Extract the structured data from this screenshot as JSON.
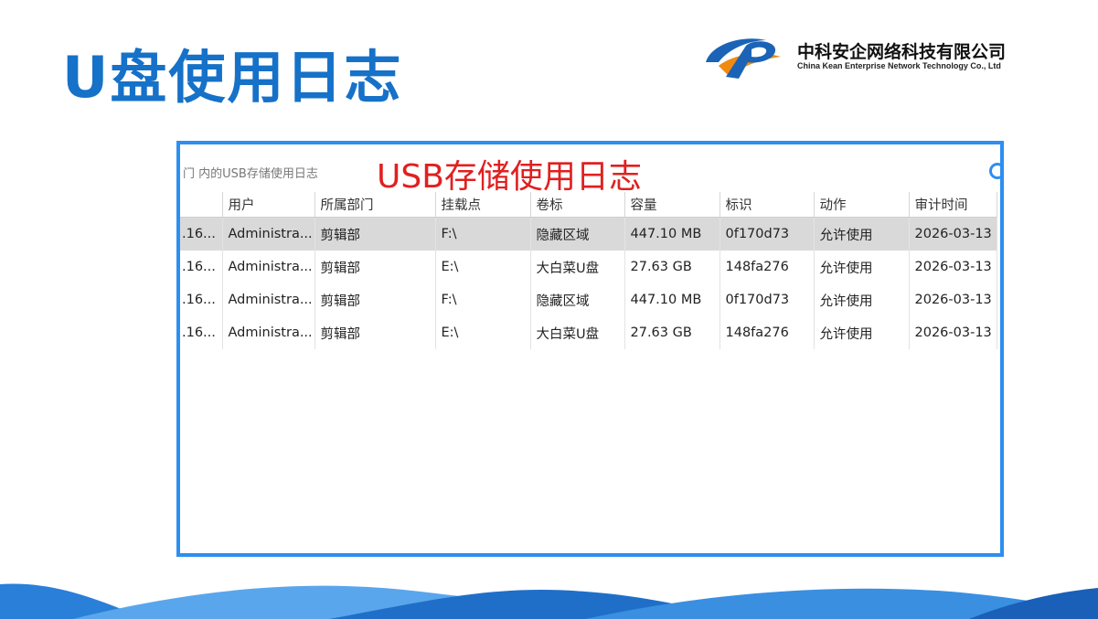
{
  "slide": {
    "title": "U盘使用日志",
    "title_color": "#1671c8"
  },
  "logo": {
    "company_cn": "中科安企网络科技有限公司",
    "company_en": "China Kean Enterprise Network Technology Co., Ltd"
  },
  "window": {
    "toolbar_text": "门 内的USB存储使用日志",
    "overlay_label": "USB存储使用日志",
    "overlay_color": "#e02020",
    "frame_color": "#2d8ff0"
  },
  "table": {
    "columns": [
      "",
      "用户",
      "所属部门",
      "挂载点",
      "卷标",
      "容量",
      "标识",
      "动作",
      "审计时间"
    ],
    "rows": [
      [
        ".16...",
        "Administra...",
        "剪辑部",
        "F:\\",
        "隐藏区域",
        "447.10 MB",
        "0f170d73",
        "允许使用",
        "2026-03-13"
      ],
      [
        ".16...",
        "Administra...",
        "剪辑部",
        "E:\\",
        "大白菜U盘",
        "27.63 GB",
        "148fa276",
        "允许使用",
        "2026-03-13"
      ],
      [
        ".16...",
        "Administra...",
        "剪辑部",
        "F:\\",
        "隐藏区域",
        "447.10 MB",
        "0f170d73",
        "允许使用",
        "2026-03-13"
      ],
      [
        ".16...",
        "Administra...",
        "剪辑部",
        "E:\\",
        "大白菜U盘",
        "27.63 GB",
        "148fa276",
        "允许使用",
        "2026-03-13"
      ]
    ],
    "selected_row": 0
  }
}
